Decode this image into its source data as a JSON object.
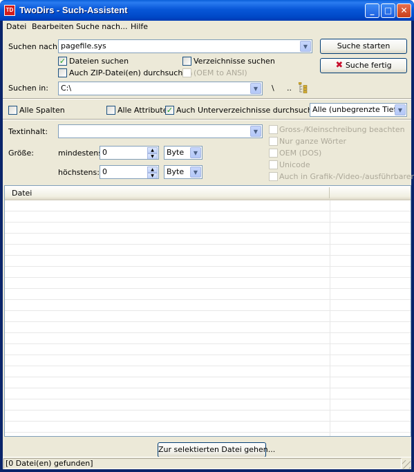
{
  "window": {
    "title": "TwoDirs - Such-Assistent",
    "app_icon": "TD"
  },
  "titlebar_buttons": {
    "minimize": "_",
    "maximize": "□",
    "close": "✕"
  },
  "menu": [
    "Datei",
    "Bearbeiten",
    "Suche nach...",
    "Hilfe"
  ],
  "search": {
    "label": "Suchen nach:",
    "value": "pagefile.sys",
    "start_button": "Suche starten",
    "done_button": "Suche fertig",
    "files_label": "Dateien suchen",
    "files_checked": true,
    "dirs_label": "Verzeichnisse suchen",
    "dirs_checked": false,
    "zip_label": "Auch ZIP-Datei(en) durchsuchen",
    "zip_checked": false,
    "oem_ansi_label": "(OEM to ANSI)"
  },
  "location": {
    "label": "Suchen in:",
    "value": "C:\\",
    "root_btn": "\\",
    "up_btn": ".."
  },
  "options": {
    "all_columns": "Alle Spalten",
    "all_attributes": "Alle Attribute",
    "subdirs": "Auch Unterverzeichnisse durchsuchen",
    "subdirs_checked": true,
    "depth": "Alle (unbegrenzte Tiefe)"
  },
  "content": {
    "label": "Textinhalt:",
    "value": "",
    "case_sensitive": "Gross-/Kleinschreibung beachten",
    "whole_words": "Nur ganze Wörter",
    "oem_dos": "OEM (DOS)",
    "unicode": "Unicode",
    "binaries": "Auch in Grafik-/Video-/ausführbaren"
  },
  "size": {
    "label": "Größe:",
    "min_label": "mindestens:",
    "min_value": "0",
    "min_unit": "Byte",
    "max_label": "höchstens:",
    "max_value": "0",
    "max_unit": "Byte"
  },
  "results": {
    "column_header": "Datei"
  },
  "goto_button": "Zur selektierten Datei gehen...",
  "status": "[0 Datei(en) gefunden]"
}
